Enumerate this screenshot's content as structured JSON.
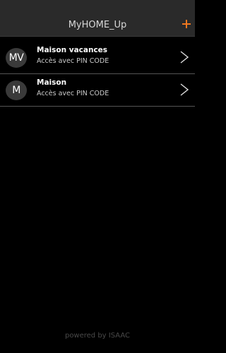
{
  "header": {
    "title": "MyHOME_Up",
    "add_icon": "plus-icon",
    "accent_color": "#f07820"
  },
  "homes": [
    {
      "initials": "MV",
      "name": "Maison vacances",
      "subtitle": "Accès avec PIN CODE",
      "icon": "chevron-right-icon"
    },
    {
      "initials": "M",
      "name": "Maison",
      "subtitle": "Accès avec PIN CODE",
      "icon": "chevron-right-icon"
    }
  ],
  "footer": {
    "text": "powered by ISAAC"
  }
}
